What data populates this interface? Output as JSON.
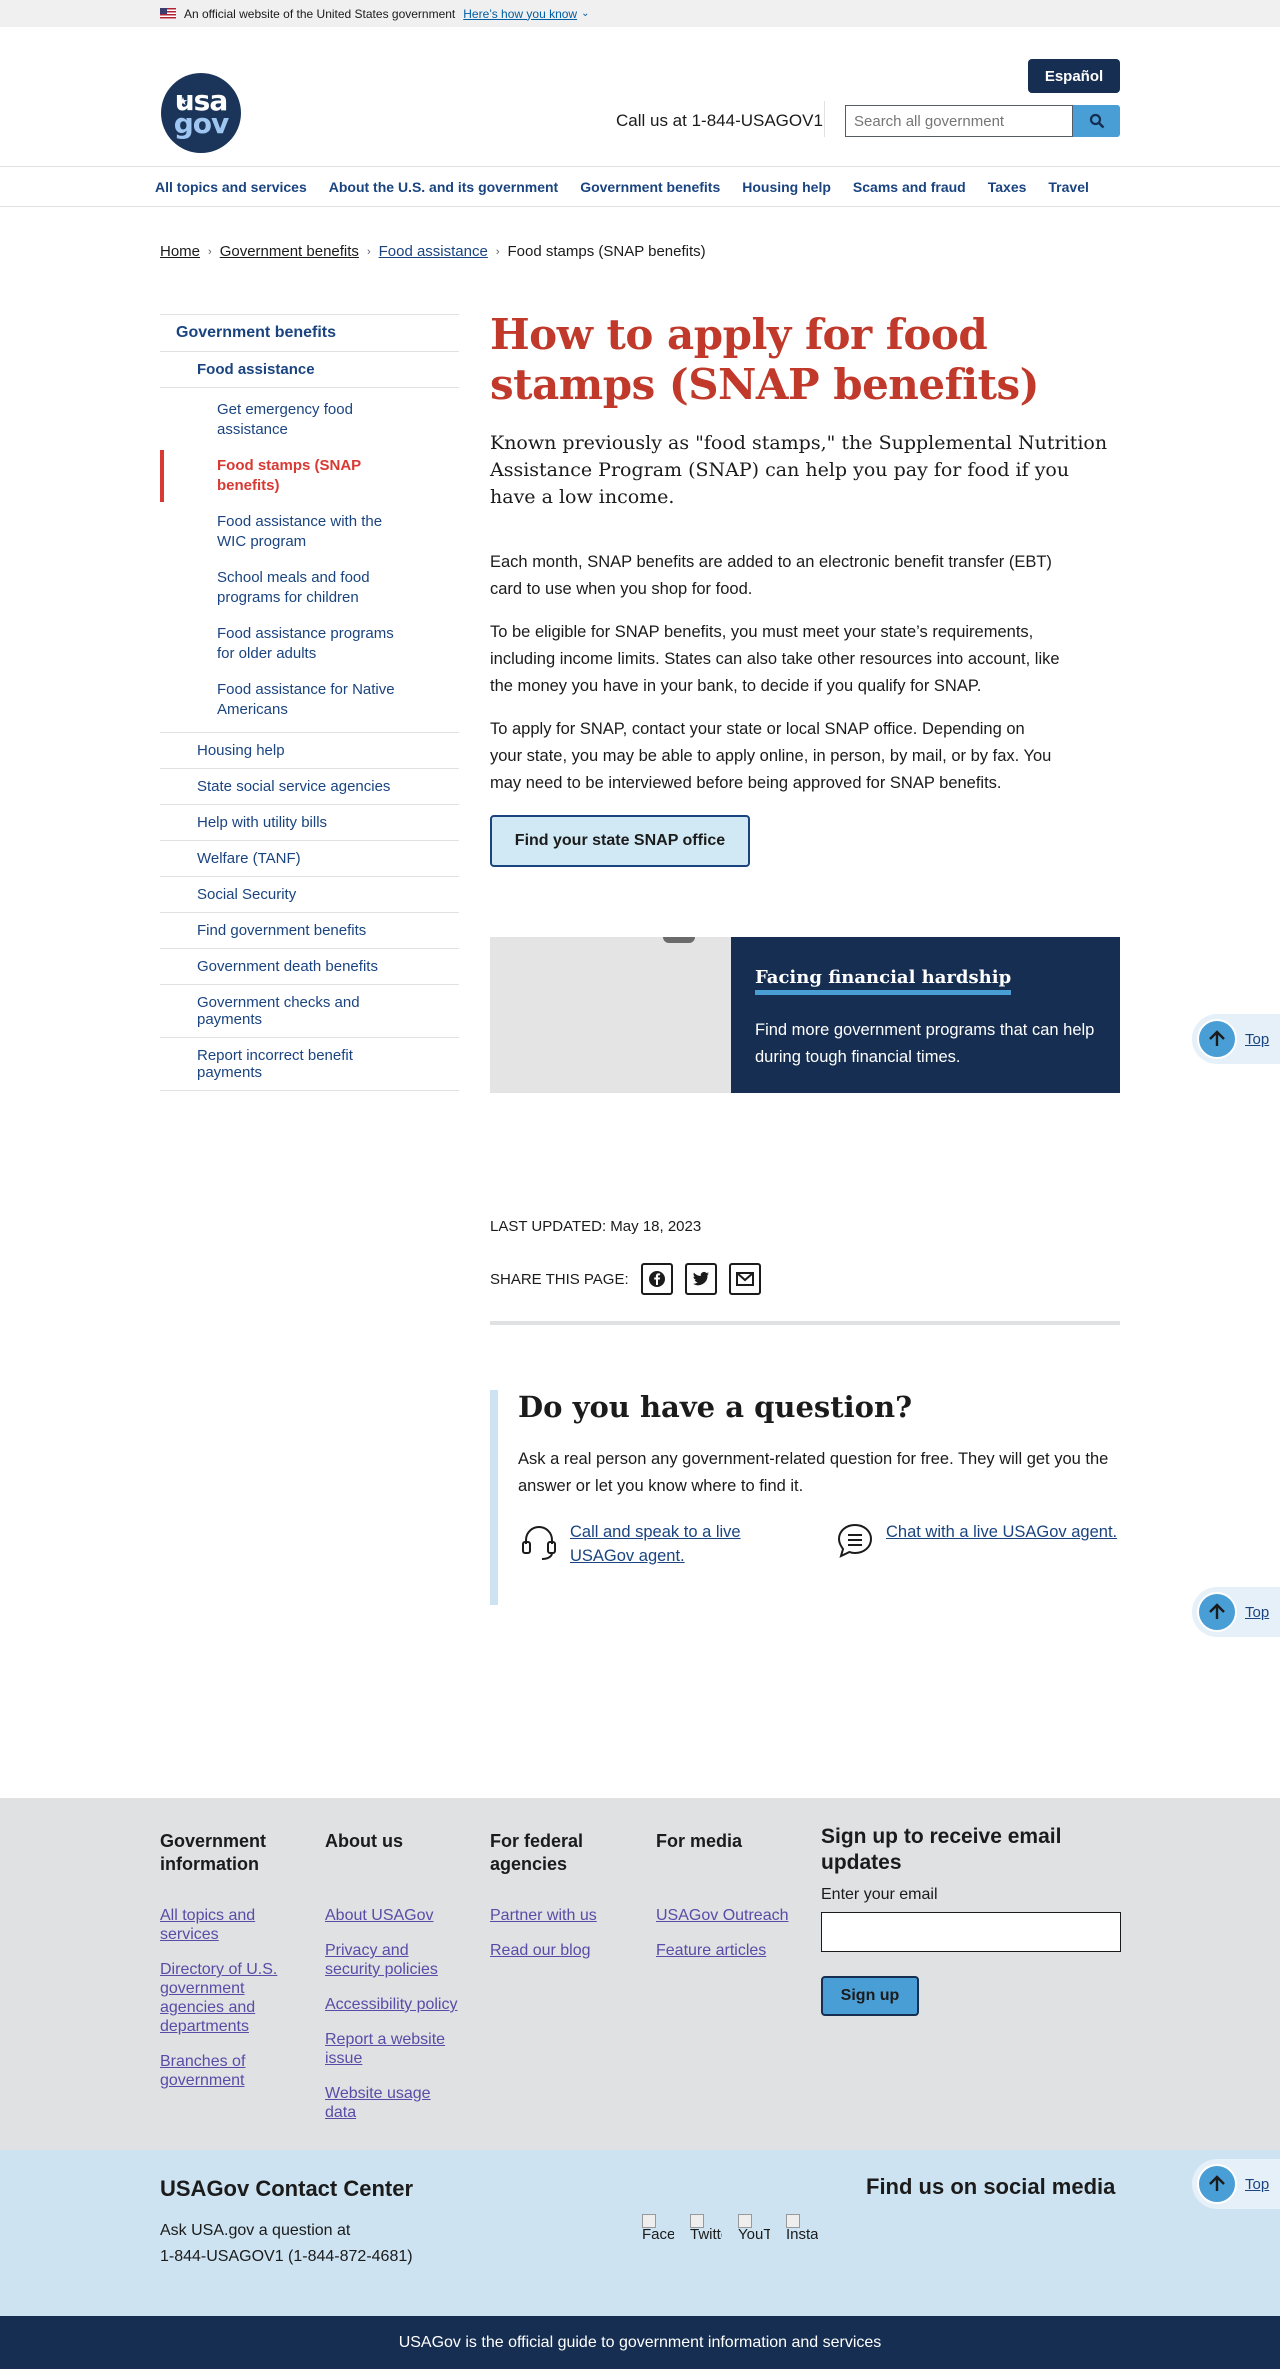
{
  "banner": {
    "text": "An official website of the United States government",
    "link": "Here’s how you know"
  },
  "header": {
    "logo_top": "usa",
    "logo_bottom": "gov",
    "language_button": "Español",
    "call_text": "Call us at 1-844-USAGOV1",
    "search_placeholder": "Search all government"
  },
  "nav": [
    "All topics and services",
    "About the U.S. and its government",
    "Government benefits",
    "Housing help",
    "Scams and fraud",
    "Taxes",
    "Travel"
  ],
  "breadcrumb": {
    "home": "Home",
    "benefits": "Government benefits",
    "food": "Food assistance",
    "current": "Food stamps (SNAP benefits)"
  },
  "sidenav": {
    "top": "Government benefits",
    "food_assistance": "Food assistance",
    "sub": [
      "Get emergency food assistance",
      "Food stamps (SNAP benefits)",
      "Food assistance with the WIC program",
      "School meals and food programs for children",
      "Food assistance programs for older adults",
      "Food assistance for Native Americans"
    ],
    "others": [
      "Housing help",
      "State social service agencies",
      "Help with utility bills",
      "Welfare (TANF)",
      "Social Security",
      "Find government benefits",
      "Government death benefits",
      "Government checks and payments",
      "Report incorrect benefit payments"
    ]
  },
  "main": {
    "title": "How to apply for food stamps (SNAP benefits)",
    "lede": "Known previously as \"food stamps,\" the Supplemental Nutrition Assistance Program (SNAP) can help you pay for food if you have a low income.",
    "paragraphs": [
      "Each month, SNAP benefits are added to an electronic benefit transfer (EBT) card to use when you shop for food.",
      "To be eligible for SNAP benefits, you must meet your state’s requirements, including income limits. States can also take other resources into account, like the money you have in your bank, to decide if you qualify for SNAP.",
      "To apply for SNAP, contact your state or local SNAP office. Depending on your state, you may be able to apply online, in person, by mail, or by fax. You may need to be interviewed before being approved for SNAP benefits."
    ],
    "cta": "Find your state SNAP office"
  },
  "card": {
    "title": "Facing financial hardship",
    "text": "Find more government programs that can help during tough financial times."
  },
  "meta": {
    "last_updated": "LAST UPDATED: May 18, 2023",
    "share_label": "SHARE THIS PAGE:"
  },
  "question": {
    "title": "Do you have a question?",
    "text": "Ask a real person any government-related question for free. They will get you the answer or let you know where to find it.",
    "call_link": "Call and speak to a live USAGov agent.",
    "chat_link": "Chat with a live USAGov agent."
  },
  "top_label": "Top",
  "footer": {
    "col1": {
      "title": "Government information",
      "links": [
        "All topics and services",
        "Directory of U.S. government agencies and departments",
        "Branches of government"
      ]
    },
    "col2": {
      "title": "About us",
      "links": [
        "About USAGov",
        "Privacy and security policies",
        "Accessibility policy",
        "Report a website issue",
        "Website usage data"
      ]
    },
    "col3": {
      "title": "For federal agencies",
      "links": [
        "Partner with us",
        "Read our blog"
      ]
    },
    "col4": {
      "title": "For media",
      "links": [
        "USAGov Outreach",
        "Feature articles"
      ]
    },
    "signup": {
      "title": "Sign up to receive email updates",
      "label": "Enter your email",
      "button": "Sign up"
    }
  },
  "contact": {
    "title": "USAGov Contact Center",
    "line1": "Ask USA.gov a question at",
    "line2": "1-844-USAGOV1 (1-844-872-4681)",
    "social_title": "Find us on social media",
    "social": [
      "Facebook",
      "Twitter",
      "YouTube",
      "Instagram"
    ]
  },
  "bottom": "USAGov is the official guide to government information and services",
  "colors": {
    "title_red": "#c0392b",
    "navy": "#162e51",
    "link_blue": "#1a4480",
    "accent_blue": "#4a9ed6"
  }
}
